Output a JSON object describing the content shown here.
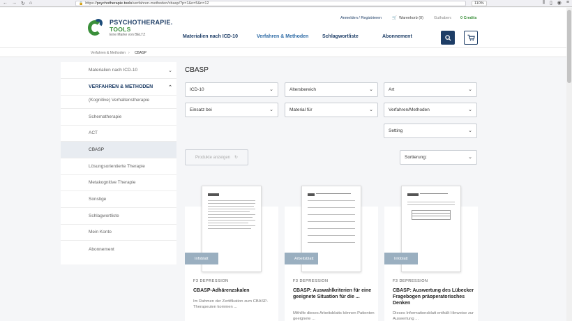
{
  "browser": {
    "url_prefix": "https://",
    "url_host": "psychotherapie.tools",
    "url_path": "/verfahren-methoden/cbasp/?p=1&o=5&n=12",
    "zoom": "110%"
  },
  "brand": {
    "line1": "PSYCHOTHERAPIE.",
    "line2": "TOOLS",
    "line3": "Eine Marke von BELTZ"
  },
  "topbar": {
    "login": "Anmelden / Registrieren",
    "cart": "Warenkorb (0)",
    "credit_label": "Guthaben:",
    "credit_value": "0 Credits"
  },
  "nav": {
    "materials": "Materialien nach ICD-10",
    "methods": "Verfahren & Methoden",
    "keywords": "Schlagwortliste",
    "subscription": "Abonnement"
  },
  "breadcrumb": {
    "parent": "Verfahren & Methoden",
    "current": "CBASP"
  },
  "sidebar": {
    "items": [
      {
        "label": "Materialien nach ICD-10",
        "chevron": "⌄"
      },
      {
        "label": "VERFAHREN & METHODEN",
        "chevron": "⌃"
      },
      {
        "label": "(Kognitive) Verhaltenstherapie"
      },
      {
        "label": "Schematherapie"
      },
      {
        "label": "ACT"
      },
      {
        "label": "CBASP"
      },
      {
        "label": "Lösungsorientierte Therapie"
      },
      {
        "label": "Metakognitive Therapie"
      },
      {
        "label": "Sonstige"
      },
      {
        "label": "Schlagwortliste"
      },
      {
        "label": "Mein Konto"
      },
      {
        "label": "Abonnement"
      }
    ]
  },
  "page": {
    "title": "CBASP"
  },
  "filters": {
    "icd10": "ICD-10",
    "age": "Altersbereich",
    "type": "Art",
    "usage": "Einsatz bei",
    "material": "Material für",
    "method": "Verfahren/Methoden",
    "setting": "Setting",
    "show_products": "Produkte anzeigen",
    "sort": "Sortierung:"
  },
  "products": [
    {
      "tag": "Infoblatt",
      "category": "F3 DEPRESSION",
      "title": "CBASP-Adhärenzskalen",
      "desc": "Im Rahmen der Zertifikation zum CBASP-Therapeuten kommen ..."
    },
    {
      "tag": "Arbeitsblatt",
      "category": "F3 DEPRESSION",
      "title": "CBASP: Auswahlkriterien für eine geeignete Situation für die ...",
      "desc": "Mithilfe dieses Arbeitsblatts können Patienten geeignete ..."
    },
    {
      "tag": "Infoblatt",
      "category": "F3 DEPRESSION",
      "title": "CBASP: Auswertung des Lübecker Fragebogen präoperatorisches Denken",
      "desc": "Dieses Informationsblatt enthält Hinweise zur Auswertung ..."
    }
  ],
  "colors": {
    "navy": "#1d3d66",
    "green": "#3a8f3a",
    "tag": "#9aafc0"
  }
}
